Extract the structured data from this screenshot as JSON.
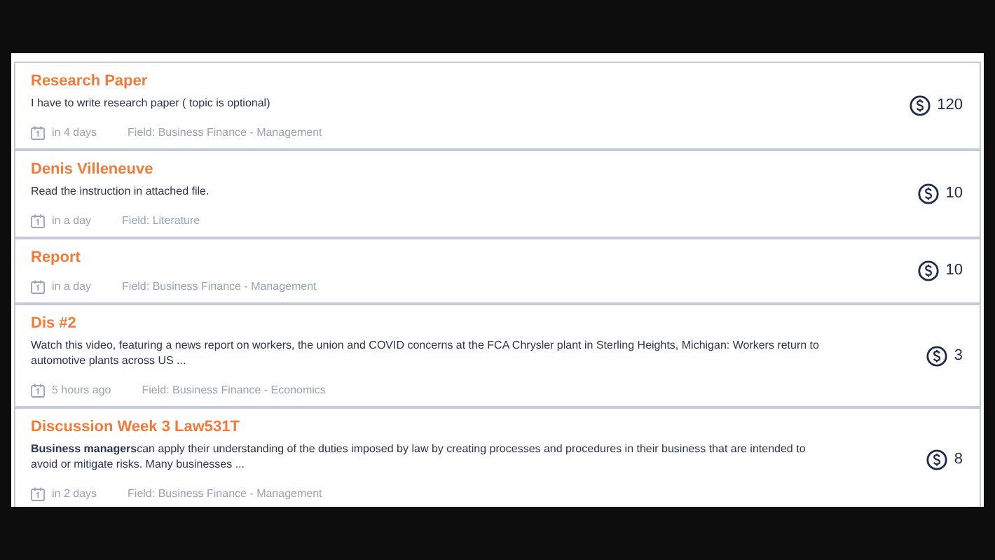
{
  "tasks": [
    {
      "title": "Research Paper",
      "description": "I have to write research paper ( topic is optional)",
      "due": "in 4 days",
      "field": "Field: Business Finance - Management",
      "price": "120"
    },
    {
      "title": "Denis Villeneuve",
      "description": "Read the instruction in attached file.",
      "due": "in a day",
      "field": "Field: Literature",
      "price": "10"
    },
    {
      "title": "Report",
      "due": "in a day",
      "field": "Field: Business Finance - Management",
      "price": "10"
    },
    {
      "title": "Dis #2",
      "description": "Watch this video, featuring a news report on workers, the union and COVID concerns at the FCA Chrysler plant in Sterling Heights, Michigan: Workers return to automotive plants across US ...",
      "due": "5 hours ago",
      "field": "Field: Business Finance - Economics",
      "price": "3"
    },
    {
      "title": "Discussion Week 3 Law531T",
      "description": "**Business managers**can apply their understanding of the duties imposed by law by creating processes and procedures in their business that are intended to avoid or mitigate risks. Many businesses ...",
      "due": "in 2 days",
      "field": "Field: Business Finance - Management",
      "price": "8"
    }
  ]
}
